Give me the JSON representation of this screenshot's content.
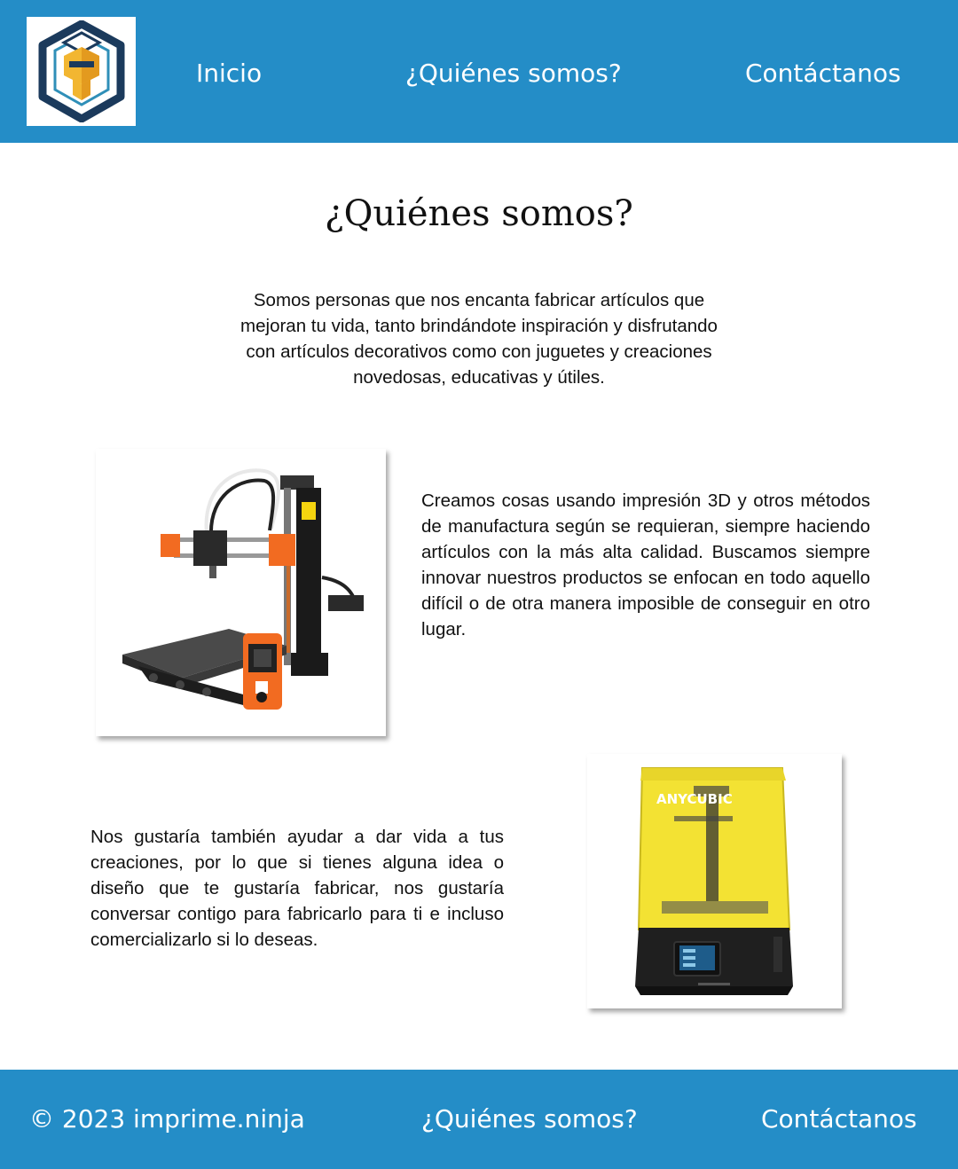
{
  "header": {
    "nav": {
      "home": "Inicio",
      "about": "¿Quiénes somos?",
      "contact": "Contáctanos"
    }
  },
  "main": {
    "title": "¿Quiénes somos?",
    "intro": "Somos personas que nos encanta fabricar artículos que mejoran tu vida, tanto brindándote inspiración y disfrutando con artículos decorativos como con juguetes y creaciones novedosas, educativas y útiles.",
    "section1": {
      "text": "Creamos cosas usando impresión 3D y otros métodos de manufactura según se requieran, siempre haciendo artículos con la más alta calidad. Buscamos siempre innovar nuestros productos se enfocan en todo aquello difícil o de otra manera imposible de conseguir en otro lugar.",
      "image_icon": "fdm-3d-printer-image"
    },
    "section2": {
      "text": "Nos gustaría también ayudar a dar vida a tus creaciones, por lo que si tienes alguna idea o diseño que te gustaría fabricar, nos gustaría conversar contigo para fabricarlo para ti e incluso comercializarlo si lo deseas.",
      "image_icon": "resin-3d-printer-image",
      "printer_brand": "ANYCUBIC"
    }
  },
  "footer": {
    "copyright": "© 2023 imprime.ninja",
    "about": "¿Quiénes somos?",
    "contact": "Contáctanos"
  },
  "colors": {
    "brand_blue": "#248dc7",
    "logo_navy": "#1b3a5c",
    "logo_gold": "#f2b631",
    "printer_orange": "#f26b21",
    "resin_yellow": "#f3e233"
  }
}
